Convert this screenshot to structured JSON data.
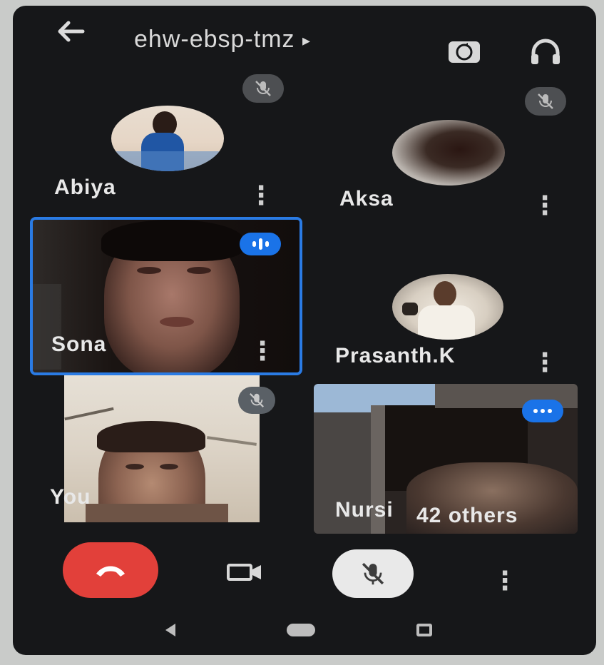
{
  "header": {
    "meeting_code": "ehw-ebsp-tmz",
    "meeting_code_arrow": "▸"
  },
  "participants": [
    {
      "name": "Abiya"
    },
    {
      "name": "Aksa"
    },
    {
      "name": "Sona"
    },
    {
      "name": "Prasanth.K"
    },
    {
      "name": "You"
    },
    {
      "name": "Nursi",
      "others_label": "42 others"
    }
  ],
  "controls": {
    "more_label": "⋮"
  },
  "icons": {
    "back": "back-arrow-icon",
    "switch_camera": "switch-camera-icon",
    "audio": "headphones-icon",
    "end_call": "end-call-icon",
    "camera": "camera-icon",
    "mic_off": "mic-off-icon"
  },
  "colors": {
    "end_call": "#e2403a",
    "active_speaker_border": "#2a7be4",
    "speaking_badge": "#1a73e8"
  }
}
